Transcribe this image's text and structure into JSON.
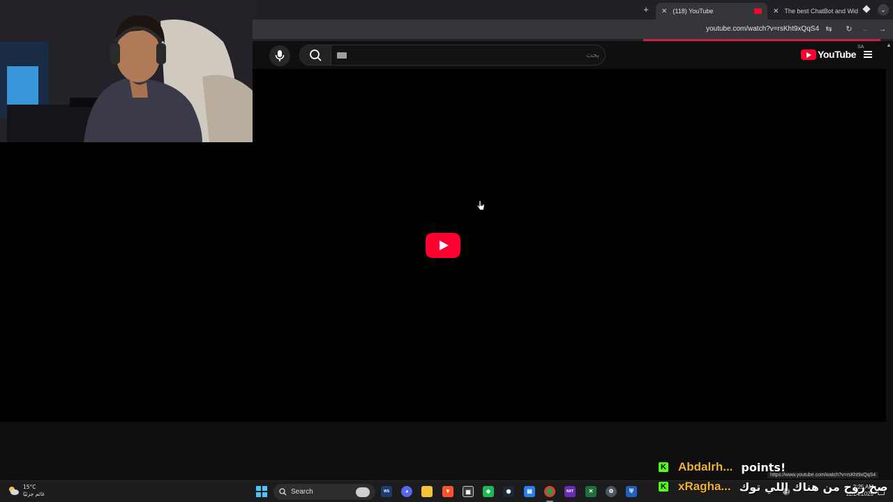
{
  "browser": {
    "tabs": [
      {
        "label": "(118) YouTube",
        "active": true
      },
      {
        "label": "The best ChatBot and Widgets",
        "active": false
      }
    ],
    "url": "youtube.com/watch?v=rsKht9xQqS4",
    "status_url": "https://www.youtube.com/watch?v=rsKht9xQqS4"
  },
  "youtube": {
    "logo_text": "YouTube",
    "country_code": "SA",
    "search_placeholder": "بحث",
    "brand_color": "#ff0033"
  },
  "chat": [
    {
      "user": "Abdalrh...",
      "message": "points!",
      "platform": "kick"
    },
    {
      "user": "xRagha...",
      "message": "صح روح من هناك إللي توك",
      "platform": "kick"
    }
  ],
  "taskbar": {
    "weather_temp": "15°C",
    "weather_desc": "غائم جزئيًا",
    "search_label": "Search",
    "time": "2:25 AM",
    "date": "11/24/2025",
    "apps": [
      "wireshark",
      "discord",
      "file-explorer",
      "brave",
      "store",
      "xbox",
      "steam",
      "notepad",
      "chrome",
      "next",
      "excel",
      "settings",
      "bot"
    ]
  }
}
